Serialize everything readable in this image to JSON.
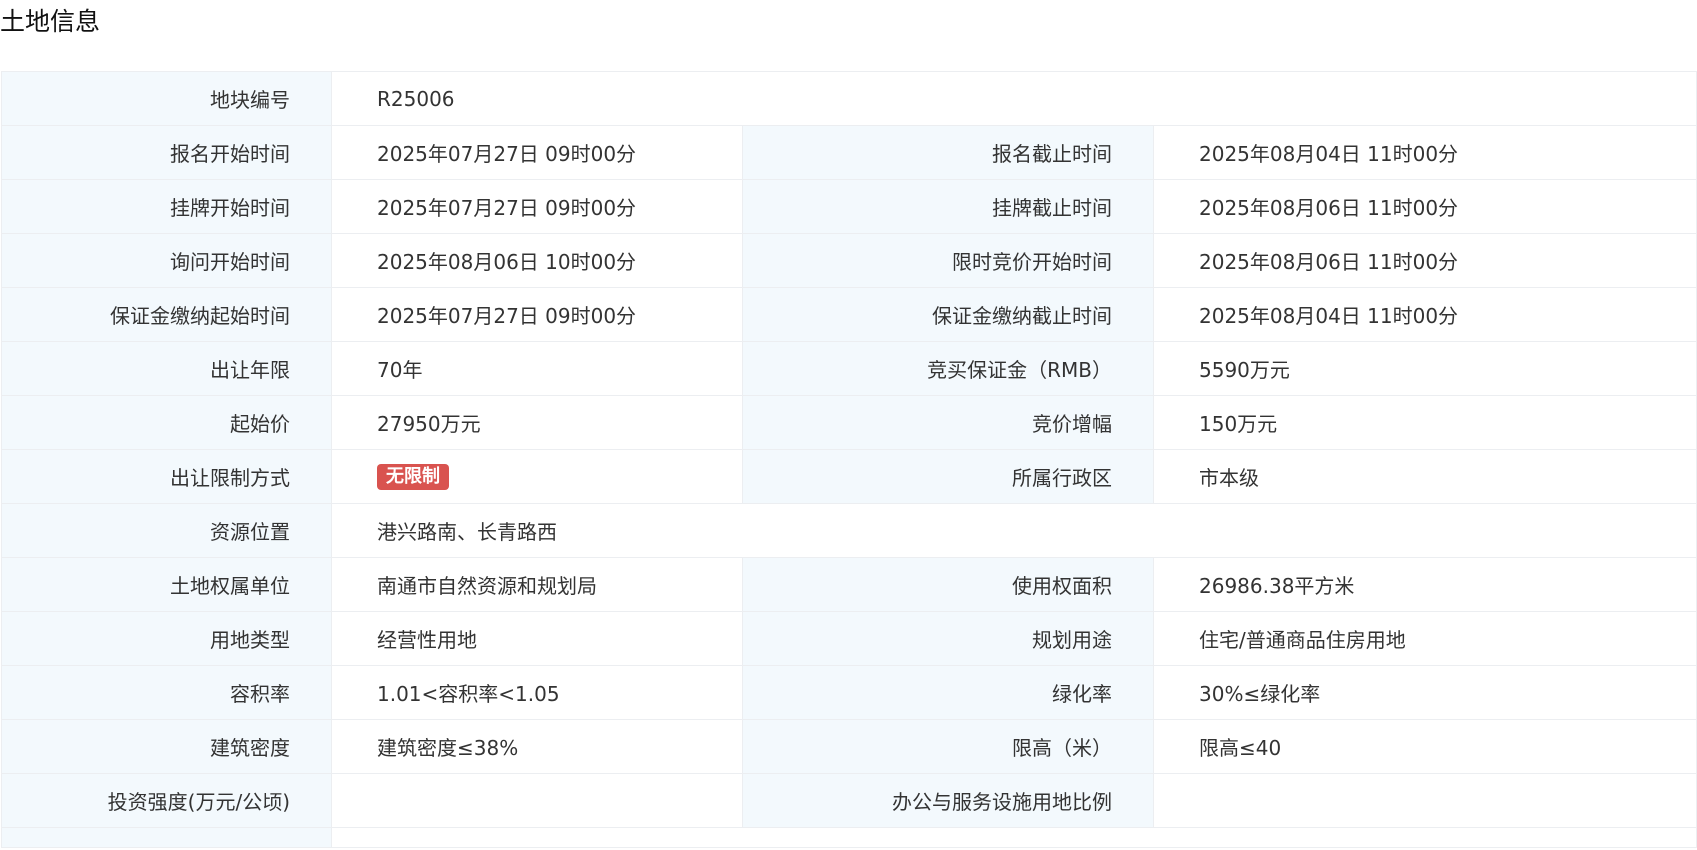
{
  "page": {
    "title": "土地信息"
  },
  "land": {
    "rows": [
      {
        "l1": "地块编号",
        "v1": "R25006"
      },
      {
        "l1": "报名开始时间",
        "v1": "2025年07月27日 09时00分",
        "l2": "报名截止时间",
        "v2": "2025年08月04日 11时00分"
      },
      {
        "l1": "挂牌开始时间",
        "v1": "2025年07月27日 09时00分",
        "l2": "挂牌截止时间",
        "v2": "2025年08月06日 11时00分"
      },
      {
        "l1": "询问开始时间",
        "v1": "2025年08月06日 10时00分",
        "l2": "限时竞价开始时间",
        "v2": "2025年08月06日 11时00分"
      },
      {
        "l1": "保证金缴纳起始时间",
        "v1": "2025年07月27日 09时00分",
        "l2": "保证金缴纳截止时间",
        "v2": "2025年08月04日 11时00分"
      },
      {
        "l1": "出让年限",
        "v1": "70年",
        "l2": "竞买保证金（RMB）",
        "v2": "5590万元"
      },
      {
        "l1": "起始价",
        "v1": "27950万元",
        "l2": "竞价增幅",
        "v2": "150万元"
      },
      {
        "l1": "出让限制方式",
        "badge": "无限制",
        "l2": "所属行政区",
        "v2": "市本级"
      },
      {
        "l1": "资源位置",
        "v1": "港兴路南、长青路西"
      },
      {
        "l1": "土地权属单位",
        "v1": "南通市自然资源和规划局",
        "l2": "使用权面积",
        "v2": "26986.38平方米"
      },
      {
        "l1": "用地类型",
        "v1": "经营性用地",
        "l2": "规划用途",
        "v2": "住宅/普通商品住房用地"
      },
      {
        "l1": "容积率",
        "v1": "1.01<容积率<1.05",
        "l2": "绿化率",
        "v2": "30%≤绿化率"
      },
      {
        "l1": "建筑密度",
        "v1": "建筑密度≤38%",
        "l2": "限高（米）",
        "v2": "限高≤40"
      },
      {
        "l1": "投资强度(万元/公顷)",
        "v1": "",
        "l2": "办公与服务设施用地比例",
        "v2": ""
      }
    ]
  },
  "colors": {
    "label_bg": "#f3f9fd",
    "border": "#eceef1",
    "badge_bg": "#d9534f"
  }
}
